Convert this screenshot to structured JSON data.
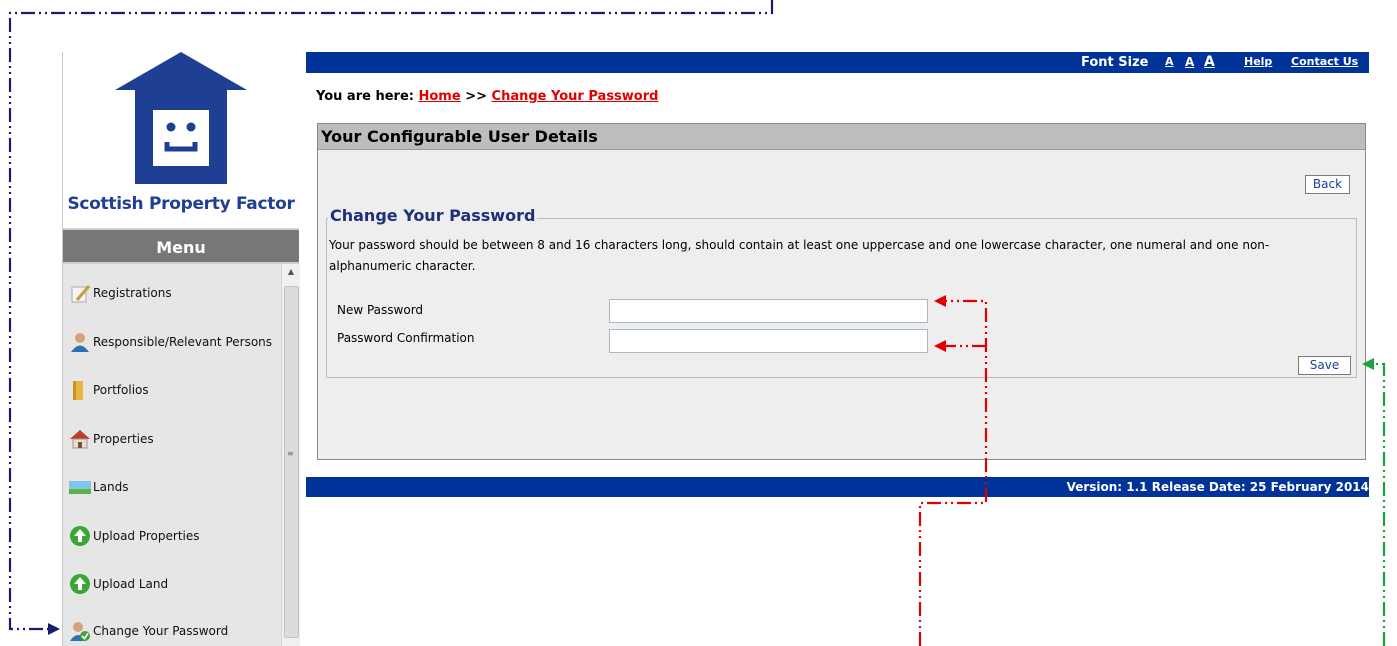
{
  "brand": {
    "name": "Scottish Property Factor"
  },
  "sidebar": {
    "menu_title": "Menu",
    "items": [
      {
        "label": "Registrations",
        "icon": "document-pencil-icon"
      },
      {
        "label": "Responsible/Relevant Persons",
        "icon": "person-icon"
      },
      {
        "label": "Portfolios",
        "icon": "folder-icon"
      },
      {
        "label": "Properties",
        "icon": "house-icon"
      },
      {
        "label": "Lands",
        "icon": "landscape-icon"
      },
      {
        "label": "Upload Properties",
        "icon": "upload-arrow-icon"
      },
      {
        "label": "Upload Land",
        "icon": "upload-arrow-icon"
      },
      {
        "label": "Change Your Password",
        "icon": "user-check-icon"
      }
    ]
  },
  "topbar": {
    "font_size_label": "Font Size",
    "font_sizes": [
      "A",
      "A",
      "A"
    ],
    "help": "Help",
    "contact": "Contact Us"
  },
  "breadcrumb": {
    "prefix": "You are here:",
    "home": "Home",
    "separator": ">>",
    "current": "Change Your Password"
  },
  "panel": {
    "title": "Your Configurable User Details",
    "back_label": "Back",
    "save_label": "Save"
  },
  "form": {
    "legend": "Change Your Password",
    "instructions": "Your password should be between 8 and 16 characters long, should contain at least one uppercase and one lowercase character, one numeral and one non-alphanumeric character.",
    "new_password_label": "New Password",
    "new_password_value": "",
    "confirm_label": "Password Confirmation",
    "confirm_value": ""
  },
  "footer": {
    "version_text": "Version: 1.1 Release Date: 25 February 2014"
  },
  "colors": {
    "header_blue": "#003399",
    "link_red": "#e00000",
    "panel_head": "#bdbdbd",
    "annotation_navy": "#1a1a6e",
    "annotation_red": "#e00000",
    "annotation_green": "#1aa33a"
  }
}
